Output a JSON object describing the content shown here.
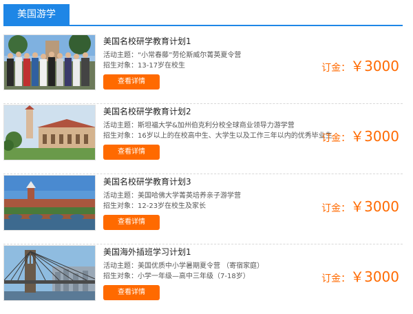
{
  "header": {
    "title": "美国游学"
  },
  "items": [
    {
      "title": "美国名校研学教育计划1",
      "theme_label": "活动主题：",
      "theme": "“小常春藤”劳伦斯威尔菁英夏令营",
      "target_label": "招生对象：",
      "target": "13-17岁在校生",
      "button": "查看详情",
      "deposit_label": "订金：",
      "deposit_value": "￥3000",
      "image": "student-group-photo"
    },
    {
      "title": "美国名校研学教育计划2",
      "theme_label": "活动主题：",
      "theme": "斯坦福大学&加州伯克利分校全球商业领导力游学营",
      "target_label": "招生对象：",
      "target": "16岁以上的在校高中生、大学生以及工作三年以内的优秀毕业生",
      "button": "查看详情",
      "deposit_label": "订金：",
      "deposit_value": "￥3000",
      "image": "stanford-campus-photo"
    },
    {
      "title": "美国名校研学教育计划3",
      "theme_label": "活动主题：",
      "theme": "美国哈佛大学菁英培养亲子游学营",
      "target_label": "招生对象：",
      "target": "12-23岁在校生及家长",
      "button": "查看详情",
      "deposit_label": "订金：",
      "deposit_value": "￥3000",
      "image": "harvard-riverside-photo"
    },
    {
      "title": "美国海外插班学习计划1",
      "theme_label": "活动主题：",
      "theme": "美国优质中小学暑期夏令营 （寄宿家庭）",
      "target_label": "招生对象：",
      "target": "小学一年级—高中三年级（7-18岁）",
      "button": "查看详情",
      "deposit_label": "订金：",
      "deposit_value": "￥3000",
      "image": "brooklyn-bridge-photo"
    }
  ],
  "colors": {
    "accent_blue": "#1e86e6",
    "accent_orange": "#ff6a00"
  }
}
